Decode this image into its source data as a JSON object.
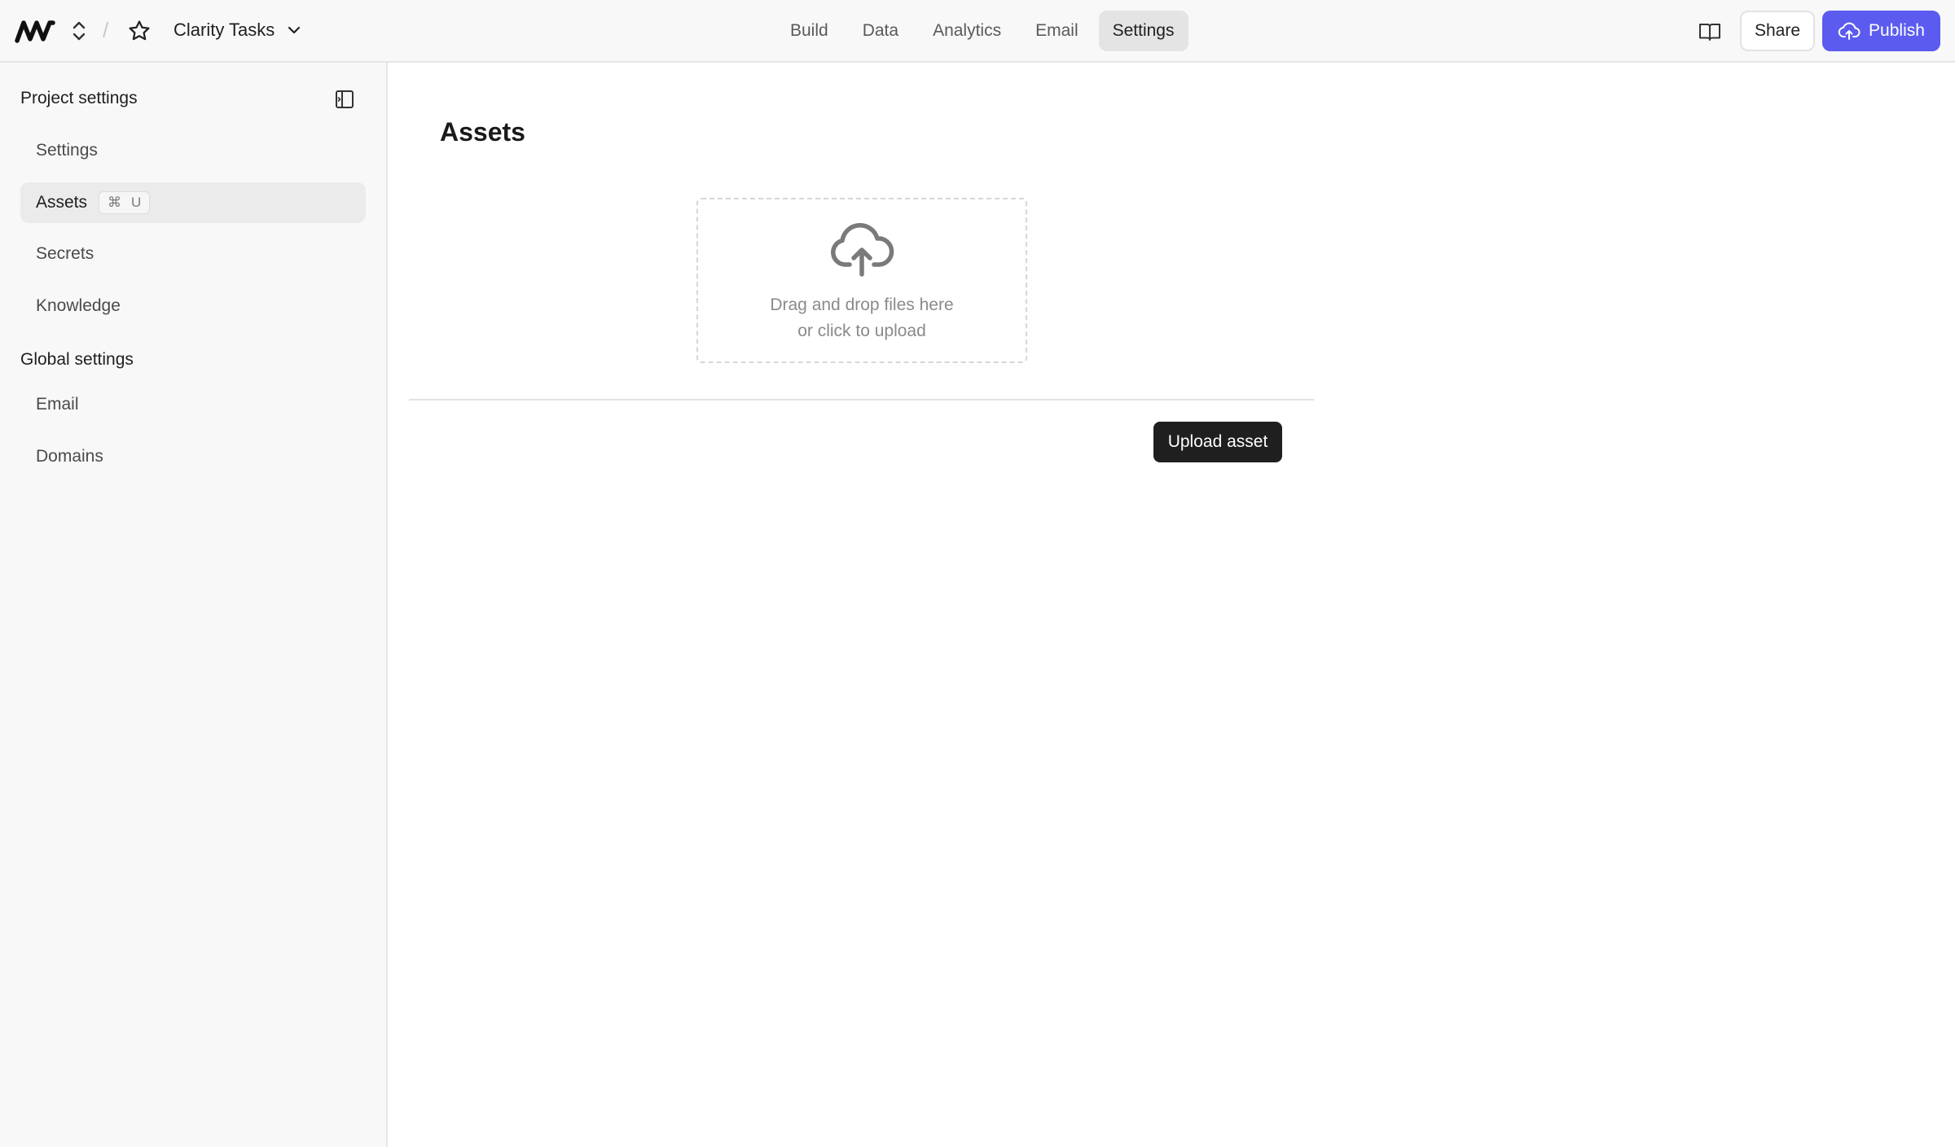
{
  "header": {
    "logo_icon": "brand-logo",
    "project_switch_icon": "chevron-up-down-icon",
    "separator": "/",
    "favorite_icon": "star-icon",
    "project_name": "Clarity Tasks",
    "project_dropdown_icon": "chevron-down-icon",
    "tabs": [
      {
        "label": "Build",
        "active": false
      },
      {
        "label": "Data",
        "active": false
      },
      {
        "label": "Analytics",
        "active": false
      },
      {
        "label": "Email",
        "active": false
      },
      {
        "label": "Settings",
        "active": true
      }
    ],
    "docs_icon": "book-icon",
    "share_label": "Share",
    "publish_label": "Publish",
    "publish_icon": "cloud-upload-icon",
    "accent_color": "#5b5bf0"
  },
  "sidebar": {
    "project_heading": "Project settings",
    "collapse_icon": "sidebar-collapse-icon",
    "project_items": [
      {
        "label": "Settings",
        "active": false
      },
      {
        "label": "Assets",
        "active": true,
        "shortcut_symbol": "⌘",
        "shortcut_key": "U"
      },
      {
        "label": "Secrets",
        "active": false
      },
      {
        "label": "Knowledge",
        "active": false
      }
    ],
    "global_heading": "Global settings",
    "global_items": [
      {
        "label": "Email",
        "active": false
      },
      {
        "label": "Domains",
        "active": false
      }
    ]
  },
  "main": {
    "title": "Assets",
    "dropzone": {
      "icon": "cloud-upload-icon",
      "line1": "Drag and drop files here",
      "line2": "or click to upload"
    },
    "upload_label": "Upload asset"
  }
}
